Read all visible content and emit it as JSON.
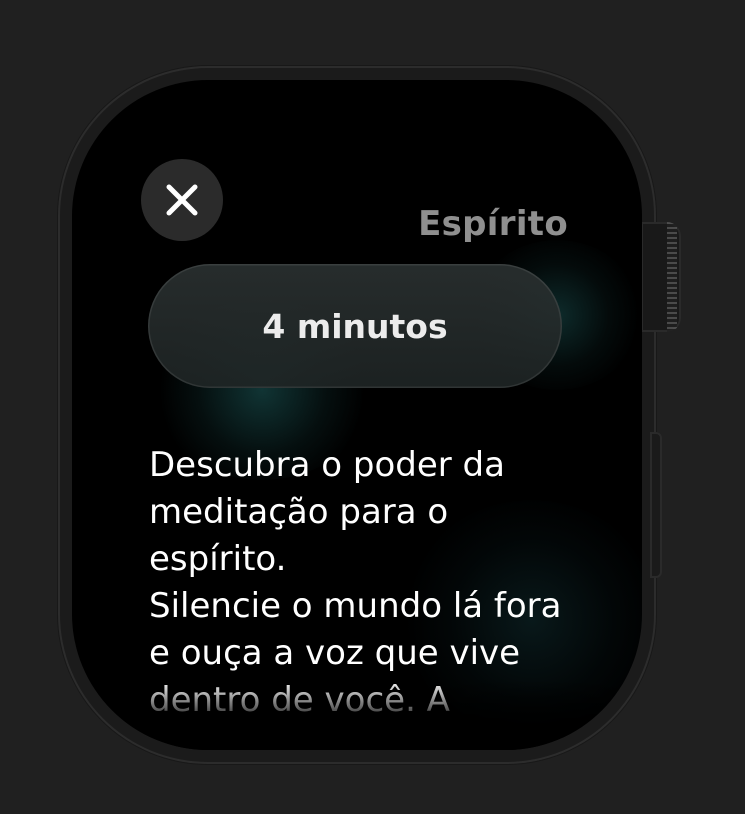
{
  "screen": {
    "title": "Espírito",
    "close_icon": "close-icon",
    "duration_button": {
      "label": "4 minutos"
    },
    "description": {
      "paragraph_1": "Descubra o poder da meditação para o espírito.",
      "paragraph_2": "Silencie o mundo lá fora e ouça a voz que vive dentro de você. A"
    }
  },
  "colors": {
    "background": "#202020",
    "screen": "#000000",
    "title": "#8f8f8f",
    "text": "#ffffff",
    "accent_glow": "#1e5f5f",
    "button_fill": "#2b2b2b"
  }
}
